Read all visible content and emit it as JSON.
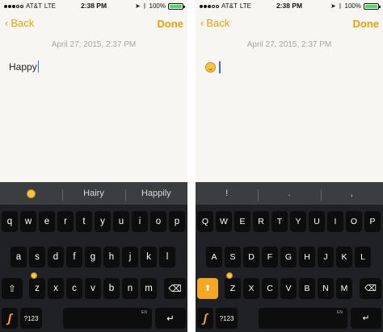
{
  "status": {
    "carrier": "AT&T",
    "network": "LTE",
    "time": "2:38 PM",
    "battery": "100%",
    "battery_level": 1.0
  },
  "nav": {
    "back_label": "Back",
    "done_label": "Done"
  },
  "colors": {
    "accent": "#e1a30a",
    "shift_active": "#f5a623",
    "key_bg": "#0d0d0e",
    "keyboard_bg": "#202124",
    "suggest_bg": "#3c3d40"
  },
  "left": {
    "date": "April 27, 2015, 2:37 PM",
    "note_text": "Happy",
    "suggestions": [
      "emoji-smile-icon",
      "Hairy",
      "Happily"
    ],
    "rows": [
      [
        "q",
        "w",
        "e",
        "r",
        "t",
        "y",
        "u",
        "i",
        "o",
        "p"
      ],
      [
        "a",
        "s",
        "d",
        "f",
        "g",
        "h",
        "j",
        "k",
        "l"
      ],
      [
        "z",
        "x",
        "c",
        "v",
        "b",
        "n",
        "m"
      ]
    ],
    "num_label": "?123",
    "space_sub": "EN"
  },
  "right": {
    "date": "April 27, 2015, 2:37 PM",
    "note_text": "emoji-smile-icon",
    "suggestions": [
      "!",
      ".",
      ","
    ],
    "rows": [
      [
        "Q",
        "W",
        "E",
        "R",
        "T",
        "Y",
        "U",
        "I",
        "O",
        "P"
      ],
      [
        "A",
        "S",
        "D",
        "F",
        "G",
        "H",
        "J",
        "K",
        "L"
      ],
      [
        "Z",
        "X",
        "C",
        "V",
        "B",
        "N",
        "M"
      ]
    ],
    "num_label": "?123",
    "space_sub": "EN"
  }
}
